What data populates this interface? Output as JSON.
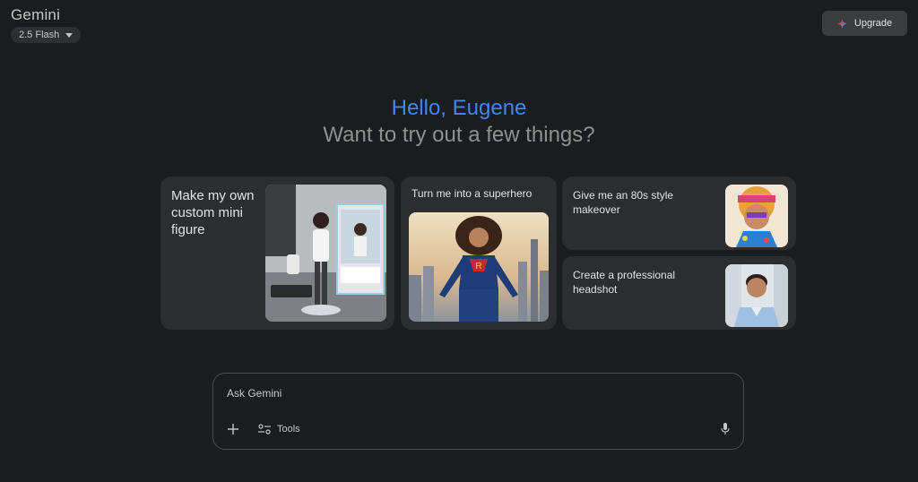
{
  "header": {
    "app_title": "Gemini",
    "model_label": "2.5 Flash",
    "upgrade_label": "Upgrade"
  },
  "greeting": {
    "hello": "Hello, Eugene",
    "prompt": "Want to try out a few things?"
  },
  "cards": [
    {
      "title": "Make my own custom mini figure",
      "image_icon": "mini-figure-photo"
    },
    {
      "title": "Turn me into a superhero",
      "image_icon": "superhero-photo"
    },
    {
      "title": "Give me an 80s style makeover",
      "image_icon": "80s-makeover-photo"
    },
    {
      "title": "Create a professional headshot",
      "image_icon": "headshot-photo"
    }
  ],
  "composer": {
    "placeholder": "Ask Gemini",
    "tools_label": "Tools"
  },
  "colors": {
    "background": "#1b1c1d",
    "card": "#2c2d2f",
    "greeting_blue": "#4285f4",
    "subtitle_gray": "#8e918f"
  }
}
